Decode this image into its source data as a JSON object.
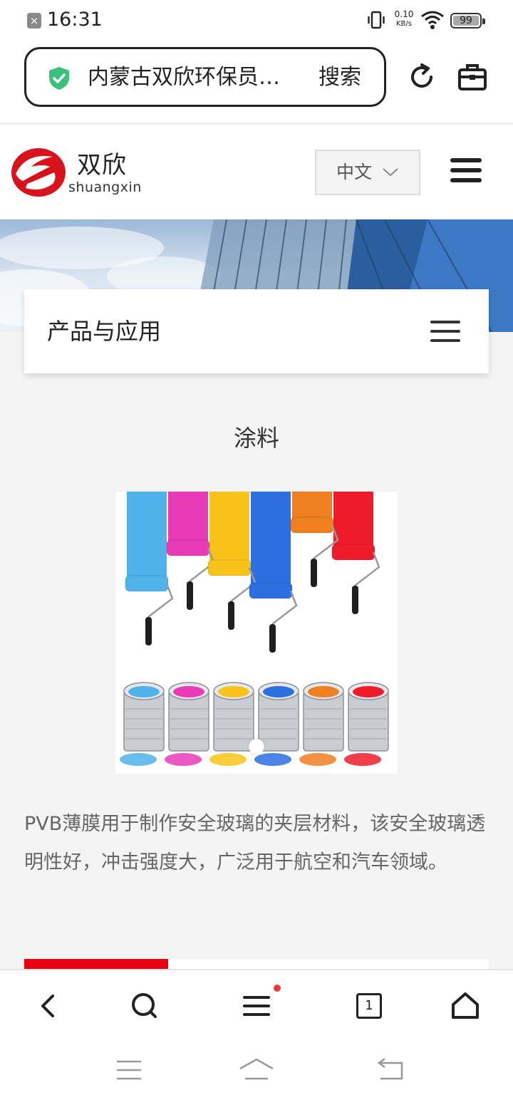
{
  "status_bar": {
    "time": "16:31",
    "net_speed_value": "0.10",
    "net_speed_unit": "KB/s",
    "battery": "99"
  },
  "browser": {
    "url_text": "内蒙古双欣环保员…",
    "search_label": "搜索",
    "tab_count": "1"
  },
  "site": {
    "logo_cn": "双欣",
    "logo_en": "shuangxin",
    "language": "中文",
    "brand_red": "#e60012"
  },
  "category": {
    "title": "产品与应用"
  },
  "product": {
    "title": "涂料",
    "description": "PVB薄膜用于制作安全玻璃的夹层材料，该安全玻璃透明性好，冲击强度大，广泛用于航空和汽车领域。",
    "paint_colors": [
      "#4fb3ea",
      "#e83bb8",
      "#f7c318",
      "#2b6fe0",
      "#f07f22",
      "#ee1c2b"
    ]
  }
}
